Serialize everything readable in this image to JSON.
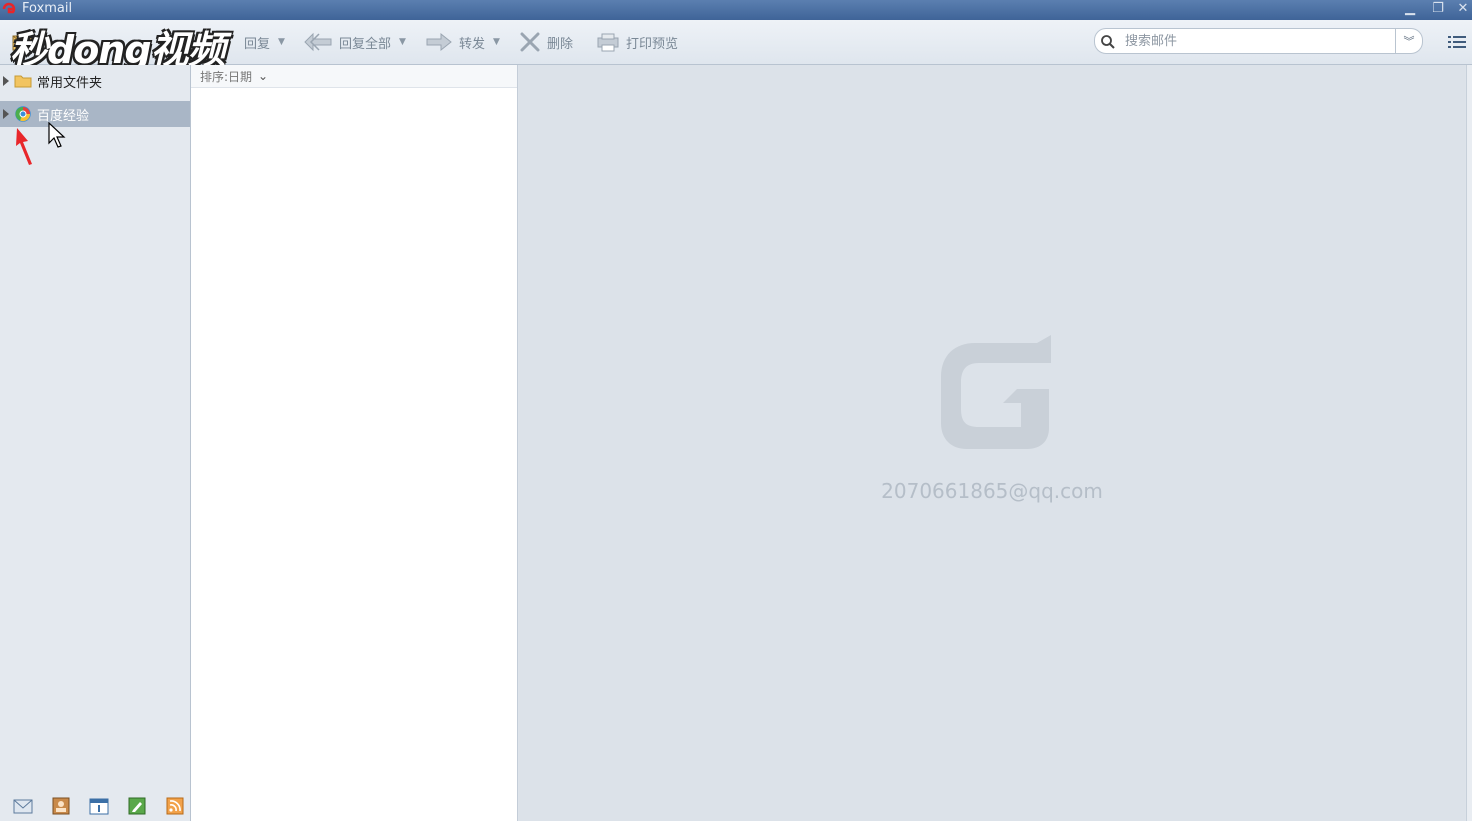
{
  "window": {
    "title": "Foxmail",
    "minimize_glyph": "▁",
    "restore_glyph": "❐",
    "close_glyph": "✕"
  },
  "watermark": {
    "text": "秒dong视频"
  },
  "toolbar": {
    "items": [
      {
        "label": "回复",
        "icon": "reply-icon",
        "has_dropdown": true
      },
      {
        "label": "回复全部",
        "icon": "reply-all-icon",
        "has_dropdown": true
      },
      {
        "label": "转发",
        "icon": "forward-icon",
        "has_dropdown": true
      },
      {
        "label": "删除",
        "icon": "delete-icon",
        "has_dropdown": false
      },
      {
        "label": "打印预览",
        "icon": "print-preview-icon",
        "has_dropdown": false
      }
    ],
    "dropdown_glyph": "▼",
    "search": {
      "placeholder": "搜索邮件",
      "value": ""
    },
    "search_options_glyph": "︾"
  },
  "sidebar": {
    "folders": [
      {
        "label": "常用文件夹",
        "icon": "folder-icon",
        "selected": false
      },
      {
        "label": "百度经验",
        "icon": "account-icon",
        "selected": true
      }
    ],
    "bottom_icons": [
      "mail-icon",
      "contacts-icon",
      "calendar-icon",
      "notes-icon",
      "rss-icon"
    ]
  },
  "message_list": {
    "sort_label": "排序:日期",
    "sort_glyph": "⌄"
  },
  "reading_pane": {
    "account_email": "2070661865@qq.com"
  },
  "colors": {
    "titlebar": "#4a6fa3",
    "selection": "#a9b6c6",
    "reading_bg": "#dce2e9",
    "annotation_arrow": "#e8262a"
  }
}
